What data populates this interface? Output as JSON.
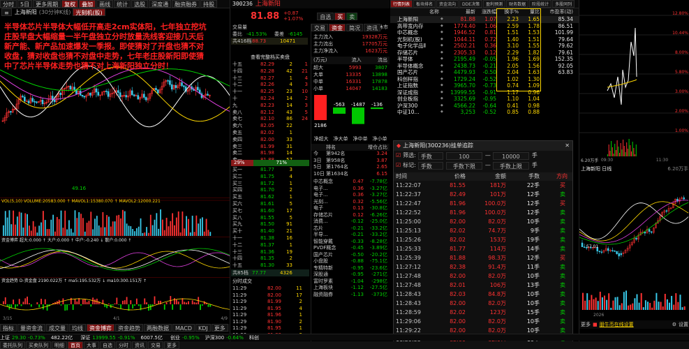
{
  "top": {
    "buttons": [
      "分时",
      "5日",
      "更多周期",
      "复权",
      "叠加",
      "画线",
      "统计",
      "选股",
      "深度通",
      "融资融券",
      "持股"
    ],
    "active_buttons": [
      "复权",
      "叠加"
    ]
  },
  "left": {
    "stock_name": "上海新阳",
    "period_label": "(30分钟K线)",
    "concept_tag": "光刻机(股)",
    "annotation": "半导体芯片半导体大幅低开高走2cm实体阳，七年独立挖坑庄股早盘大幅缩量一半午盘独立分时放量洗线客迎接几天后新产能、新产品加速爆发一季报。即使猜对了开盘也猜不对收盘，猜对收盘也猜不对盘中走势，七年老庄股新阳即使猜中了芯片半导体走势也猜不对上海新阳独立分时！",
    "low_label": "49.16",
    "high_label": "40",
    "vol_line": "VOL(5,10) VOLUME:20583.000 ↑ MAVOL1:15380.070 ↑ MAVOL2:12000.221",
    "vol_buttons": [
      "改参数",
      "加指标",
      "换指标"
    ],
    "fund_line": "资金博弈 超大:0.000 ↑ 大户:0.000 ↑ 中户:-0.240 ↓ 散户:0.000 ↑",
    "fund_buttons": [
      "改参数",
      "加指标",
      "换指标"
    ],
    "trend_line": "资金趋势 D-资金盘 2190.022万 ↑ ma5:195.532万 ↓ ma10:300.151万 ↑",
    "trend_buttons": [
      "改参数",
      "加指标",
      "换指标"
    ],
    "bottom_tabs": [
      "指标",
      "量资金流",
      "成交量",
      "均线",
      "资金博弈",
      "资金趋势",
      "两融数据",
      "MACD",
      "KDJ",
      "更多"
    ],
    "date_left": "3/15",
    "date_mid": "4/1",
    "date_right": "4/9",
    "active_bottom_tab": "资金博弈"
  },
  "middle": {
    "code": "300236",
    "name": "上海新阳",
    "price": "81.88",
    "change": "+0.87",
    "change_pct": "+1.07%",
    "self_select": "自选",
    "trade_buttons": [
      "买",
      "卖"
    ],
    "trade_status": "交易量",
    "trade_status_right": "午间休市",
    "ratio_label": "委比",
    "ratio_value": "-41.53%",
    "diff_label": "委差",
    "diff_value": "-6145",
    "sell_orders": [
      {
        "label": "十五",
        "price": "82.29",
        "vol": "2",
        "chg": "1"
      },
      {
        "label": "十四",
        "price": "82.28",
        "vol": "42",
        "chg": "21"
      },
      {
        "label": "十三",
        "price": "82.27",
        "vol": "1",
        "chg": "4"
      },
      {
        "label": "十二",
        "price": "82.26",
        "vol": "4",
        "chg": "3"
      },
      {
        "label": "十一",
        "price": "82.25",
        "vol": "23",
        "chg": "10"
      },
      {
        "label": "十",
        "price": "82.24",
        "vol": "14",
        "chg": "2"
      },
      {
        "label": "九",
        "price": "82.23",
        "vol": "14",
        "chg": "3"
      },
      {
        "label": "卖八",
        "price": "82.12",
        "vol": "43",
        "chg": "5"
      },
      {
        "label": "卖七",
        "price": "82.10",
        "vol": "86",
        "chg": "24"
      },
      {
        "label": "卖六",
        "price": "82.05",
        "vol": "22",
        "chg": ""
      },
      {
        "label": "卖五",
        "price": "82.02",
        "vol": "1",
        "chg": ""
      },
      {
        "label": "卖四",
        "price": "82.00",
        "vol": "33",
        "chg": ""
      },
      {
        "label": "卖三",
        "price": "81.99",
        "vol": "31",
        "chg": ""
      },
      {
        "label": "卖二",
        "price": "81.98",
        "vol": "14",
        "chg": ""
      },
      {
        "label": "卖一",
        "price": "81.88",
        "vol": "57",
        "chg": ""
      }
    ],
    "buy_orders": [
      {
        "label": "买一",
        "price": "81.77",
        "vol": "3",
        "chg": ""
      },
      {
        "label": "买二",
        "price": "81.75",
        "vol": "4",
        "chg": ""
      },
      {
        "label": "买三",
        "price": "81.72",
        "vol": "1",
        "chg": ""
      },
      {
        "label": "买四",
        "price": "81.70",
        "vol": "2",
        "chg": ""
      },
      {
        "label": "买五",
        "price": "81.62",
        "vol": "1",
        "chg": ""
      },
      {
        "label": "买六",
        "price": "81.61",
        "vol": "5",
        "chg": ""
      },
      {
        "label": "买七",
        "price": "81.60",
        "vol": "17",
        "chg": ""
      },
      {
        "label": "买八",
        "price": "81.55",
        "vol": "5",
        "chg": ""
      },
      {
        "label": "买九",
        "price": "81.50",
        "vol": "91",
        "chg": ""
      },
      {
        "label": "买十",
        "price": "81.40",
        "vol": "21",
        "chg": ""
      },
      {
        "label": "十一",
        "price": "81.38",
        "vol": "16",
        "chg": ""
      },
      {
        "label": "十二",
        "price": "81.37",
        "vol": "1",
        "chg": ""
      },
      {
        "label": "十三",
        "price": "81.36",
        "vol": "19",
        "chg": ""
      },
      {
        "label": "十四",
        "price": "81.35",
        "vol": "2",
        "chg": ""
      },
      {
        "label": "十五",
        "price": "81.30",
        "vol": "33",
        "chg": ""
      }
    ],
    "sell_total_label": "共416档",
    "sell_total_price": "88.73",
    "sell_total_vol": "10471",
    "buy_total_label": "共85档",
    "buy_total_price": "77.77",
    "buy_total_vol": "4326",
    "view_queue": "查看完整档买卖盘",
    "bid_ask_pct_left": "29%",
    "bid_ask_pct_right": "71%",
    "detail_tab": "分时成交",
    "ticks": [
      {
        "t": "11:29",
        "p": "82.00",
        "v": "11"
      },
      {
        "t": "11:29",
        "p": "82.00",
        "v": "17"
      },
      {
        "t": "11:29",
        "p": "81.99",
        "v": "2"
      },
      {
        "t": "11:29",
        "p": "81.95",
        "v": "4"
      },
      {
        "t": "11:29",
        "p": "81.96",
        "v": "1"
      },
      {
        "t": "11:29",
        "p": "81.90",
        "v": "2"
      },
      {
        "t": "11:29",
        "p": "81.95",
        "v": "1"
      },
      {
        "t": "11:30",
        "p": "81.88",
        "v": "3"
      }
    ],
    "tabs_right": [
      "交易",
      "资金",
      "简况",
      "资讯"
    ],
    "flow": [
      {
        "k": "主力流入",
        "v": "19328万元"
      },
      {
        "k": "主力流出",
        "v": "17705万元"
      },
      {
        "k": "主力净流入",
        "v": "1623万元"
      }
    ],
    "flow_table_head": [
      "(万元)",
      "流入",
      "流出"
    ],
    "flow_rows": [
      {
        "k": "超大",
        "in": "5993",
        "out": "3807"
      },
      {
        "k": "大单",
        "in": "13335",
        "out": "13898"
      },
      {
        "k": "中单",
        "in": "16331",
        "out": "17878"
      },
      {
        "k": "小单",
        "in": "14047",
        "out": "14183"
      }
    ],
    "flow_values": [
      "2186",
      "-563",
      "-1487",
      "-136"
    ],
    "netflow_tabs": [
      "净超大",
      "净大单",
      "净中单",
      "净小单"
    ],
    "rank_head": [
      "排名",
      "增仓占比"
    ],
    "rank_rows": [
      {
        "k": "今",
        "r": "第942名",
        "v": "3.24"
      },
      {
        "k": "3日",
        "r": "第958名",
        "v": "3.87"
      },
      {
        "k": "5日",
        "r": "第1764名",
        "v": "2.65"
      },
      {
        "k": "10日",
        "r": "第1634名",
        "v": "6.15"
      }
    ],
    "sector_rows": [
      {
        "n": "中芯概念",
        "c": "0.47",
        "v": "-7.78亿"
      },
      {
        "n": "电子...",
        "c": "0.36",
        "v": "-3.27亿"
      },
      {
        "n": "电子...",
        "c": "0.36",
        "v": "-3.27亿"
      },
      {
        "n": "光刻...",
        "c": "0.32",
        "v": "-5.56亿"
      },
      {
        "n": "电子",
        "c": "0.13",
        "v": "-30.8亿"
      },
      {
        "n": "存储芯片",
        "c": "0.12",
        "v": "-6.26亿"
      },
      {
        "n": "消费...",
        "c": "-0.12",
        "v": "-25.0亿"
      },
      {
        "n": "芯片",
        "c": "-0.21",
        "v": "-33.2亿"
      },
      {
        "n": "半导...",
        "c": "-0.21",
        "v": "-33.2亿"
      },
      {
        "n": "智能穿戴",
        "c": "-0.33",
        "v": "-8.28亿"
      },
      {
        "n": "PVDF概念",
        "c": "-0.45",
        "v": "-3.89亿"
      },
      {
        "n": "国产芯片",
        "c": "-0.50",
        "v": "-20.2亿"
      },
      {
        "n": "小盘股",
        "c": "-0.88",
        "v": "-75.1亿"
      },
      {
        "n": "专精特新",
        "c": "-0.95",
        "v": "-23.6亿"
      },
      {
        "n": "深股通",
        "c": "-0.95",
        "v": "-271亿"
      },
      {
        "n": "富时罗素",
        "c": "-1.04",
        "v": "-298亿"
      },
      {
        "n": "上海板块",
        "c": "-1.12",
        "v": "-27.5亿"
      },
      {
        "n": "融资融券",
        "c": "-1.13",
        "v": "-373亿"
      }
    ]
  },
  "right_top": {
    "tabs": [
      "行情列表",
      "板块排名",
      "资金流向",
      "DDE决策",
      "盈利预测",
      "财务数据",
      "阶段统计",
      "多股同列"
    ],
    "headers": [
      "",
      "名称",
      "",
      "最新",
      "涨跌幅",
      "换手%",
      "量比",
      "市盈率(动)"
    ],
    "rows": [
      {
        "n": "上海新阳",
        "p": "81.88",
        "c": "1.07",
        "h": "2.23",
        "q": "1.65",
        "pe": "85.34"
      },
      {
        "n": "高带宽内存",
        "p": "1774.40",
        "c": "1.06",
        "h": "2.59",
        "q": "1.78",
        "pe": "86.51"
      },
      {
        "n": "中芯概念",
        "p": "1946.52",
        "c": "0.81",
        "h": "1.51",
        "q": "1.53",
        "pe": "101.99"
      },
      {
        "n": "光刻机(股)",
        "p": "1044.11",
        "c": "0.72",
        "h": "1.40",
        "q": "1.51",
        "pe": "79.64"
      },
      {
        "n": "电子化学品Ⅱ",
        "p": "2502.21",
        "c": "0.36",
        "h": "3.10",
        "q": "1.55",
        "pe": "79.62"
      },
      {
        "n": "存储芯片",
        "p": "2305.33",
        "c": "0.12",
        "h": "2.29",
        "q": "1.82",
        "pe": "79.61"
      },
      {
        "n": "半导体",
        "p": "2195.49",
        "c": "-0.05",
        "h": "1.96",
        "q": "1.69",
        "pe": "152.35"
      },
      {
        "n": "半导体概念",
        "p": "2438.73",
        "c": "-0.21",
        "h": "2.05",
        "q": "1.56",
        "pe": "92.05"
      },
      {
        "n": "国产芯片",
        "p": "4479.93",
        "c": "-0.50",
        "h": "2.04",
        "q": "1.63",
        "pe": "63.83"
      },
      {
        "n": "科创样指",
        "p": "1729.24",
        "c": "-0.52",
        "h": "1.02",
        "q": "1.30",
        "pe": ""
      },
      {
        "n": "上证指数",
        "p": "3965.70",
        "c": "-0.73",
        "h": "0.74",
        "q": "1.09",
        "pe": ""
      },
      {
        "n": "深证成指",
        "p": "13999.55",
        "c": "-0.91",
        "h": "1.17",
        "q": "0.96",
        "pe": ""
      },
      {
        "n": "创业板指",
        "p": "3325.69",
        "c": "-0.95",
        "h": "1.10",
        "q": "1.04",
        "pe": ""
      },
      {
        "n": "沪深300",
        "p": "4566.22",
        "c": "-0.64",
        "h": "0.41",
        "q": "0.98",
        "pe": ""
      },
      {
        "n": "中证10...",
        "p": "3,253",
        "c": "-0.52",
        "h": "0.85",
        "q": "0.88",
        "pe": ""
      }
    ]
  },
  "popup": {
    "title": "上海新阳(300236)挂单追踪",
    "filter1_label": "筛选:",
    "filter1_select": "手数",
    "filter1_from": "100",
    "filter1_to": "10000",
    "filter1_unit": "手",
    "filter2_label": "标记:",
    "filter2_select": "手数",
    "filter2_from": "手数下限",
    "filter2_to": "手数上限",
    "filter2_unit": "手",
    "head": [
      "时间",
      "价格",
      "金额",
      "手数",
      "方向"
    ],
    "rows": [
      {
        "t": "11:22:07",
        "p": "81.55",
        "a": "181万",
        "v": "22手",
        "d": "买"
      },
      {
        "t": "11:22:37",
        "p": "82.49",
        "a": "101万",
        "v": "12手",
        "d": "卖"
      },
      {
        "t": "11:22:47",
        "p": "81.96",
        "a": "100.0万",
        "v": "12手",
        "d": "买"
      },
      {
        "t": "11:22:52",
        "p": "81.96",
        "a": "100.0万",
        "v": "12手",
        "d": "卖"
      },
      {
        "t": "11:25:00",
        "p": "82.00",
        "a": "82.0万",
        "v": "10手",
        "d": "卖"
      },
      {
        "t": "11:25:13",
        "p": "82.02",
        "a": "74.7万",
        "v": "9手",
        "d": "卖"
      },
      {
        "t": "11:25:26",
        "p": "82.02",
        "a": "153万",
        "v": "19手",
        "d": "卖"
      },
      {
        "t": "11:25:33",
        "p": "81.77",
        "a": "114万",
        "v": "14手",
        "d": "卖"
      },
      {
        "t": "11:25:39",
        "p": "81.88",
        "a": "98.3万",
        "v": "12手",
        "d": "买"
      },
      {
        "t": "11:27:12",
        "p": "82.38",
        "a": "91.4万",
        "v": "11手",
        "d": "卖"
      },
      {
        "t": "11:27:48",
        "p": "82.00",
        "a": "82.0万",
        "v": "10手",
        "d": "卖"
      },
      {
        "t": "11:27:48",
        "p": "82.01",
        "a": "106万",
        "v": "13手",
        "d": "卖"
      },
      {
        "t": "11:28:43",
        "p": "82.03",
        "a": "84.8万",
        "v": "10手",
        "d": "卖"
      },
      {
        "t": "11:28:43",
        "p": "82.00",
        "a": "82.0万",
        "v": "10手",
        "d": "卖"
      },
      {
        "t": "11:28:59",
        "p": "82.02",
        "a": "123万",
        "v": "15手",
        "d": "卖"
      },
      {
        "t": "11:29:06",
        "p": "82.00",
        "a": "82.0万",
        "v": "10手",
        "d": "卖"
      },
      {
        "t": "11:29:22",
        "p": "82.00",
        "a": "82.0万",
        "v": "10手",
        "d": "卖"
      },
      {
        "t": "11:29:55",
        "p": "82.00",
        "a": "82.0万",
        "v": "10手",
        "d": "卖"
      }
    ]
  },
  "far_right": {
    "top_label": "6.20万手",
    "pct_labels": [
      "12.80%",
      "10.44%",
      "8.00%",
      "5.80%",
      "3.00%",
      "2.00%",
      "1.00%"
    ],
    "bottom_title": "上海新阳 日线",
    "bottom_vol": "6.20万手",
    "low_label": "57.01",
    "year_label": "2026",
    "more_label": "更多",
    "ad_label": "朋牛币在线设置",
    "ad_right": "设置",
    "time_labels": [
      "09:30",
      "11:30"
    ]
  },
  "status": {
    "left_tabs": [
      "委托队列",
      "买卖队列",
      "明细"
    ],
    "items": [
      {
        "k": "上证",
        "v": "29.30",
        "c": "-0.73%"
      },
      {
        "k": "482.22亿",
        "v": "",
        "c": ""
      },
      {
        "k": "深证",
        "v": "13999.55",
        "c": "-0.91%"
      },
      {
        "k": "6007.5亿",
        "v": "",
        "c": ""
      },
      {
        "k": "创业",
        "v": "",
        "c": "-0.95%"
      },
      {
        "k": "沪深300",
        "v": "",
        "c": "-0.64%"
      },
      {
        "k": "科创",
        "v": "",
        "c": ""
      }
    ],
    "bottom_nav": [
      "首页",
      "大事",
      "自选",
      "分时",
      "资讯",
      "交易",
      "更多"
    ]
  },
  "colors": {
    "up": "#ff3232",
    "down": "#00d200",
    "accent": "#ffd800",
    "bg": "#000000"
  }
}
